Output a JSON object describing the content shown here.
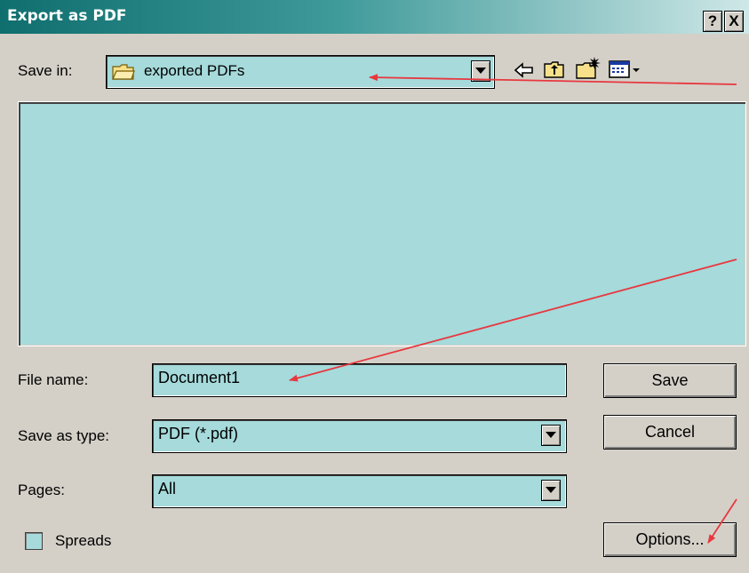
{
  "window": {
    "title": "Export as PDF",
    "help_label": "?",
    "close_label": "X"
  },
  "save_in": {
    "label": "Save in:",
    "value": "exported PDFs"
  },
  "toolbar_icons": [
    "back-icon",
    "up-folder-icon",
    "new-folder-icon",
    "view-menu-icon"
  ],
  "file_name": {
    "label": "File name:",
    "value": "Document1"
  },
  "save_as_type": {
    "label": "Save as type:",
    "value": "PDF (*.pdf)"
  },
  "pages": {
    "label": "Pages:",
    "value": "All"
  },
  "spreads": {
    "label": "Spreads",
    "checked": false
  },
  "buttons": {
    "save": "Save",
    "cancel": "Cancel",
    "options": "Options..."
  },
  "colors": {
    "field_bg": "#a6dadb",
    "dialog_bg": "#d4d0c8",
    "title_gradient_start": "#0f6e6e",
    "annotation_arrow": "#e8373e"
  }
}
